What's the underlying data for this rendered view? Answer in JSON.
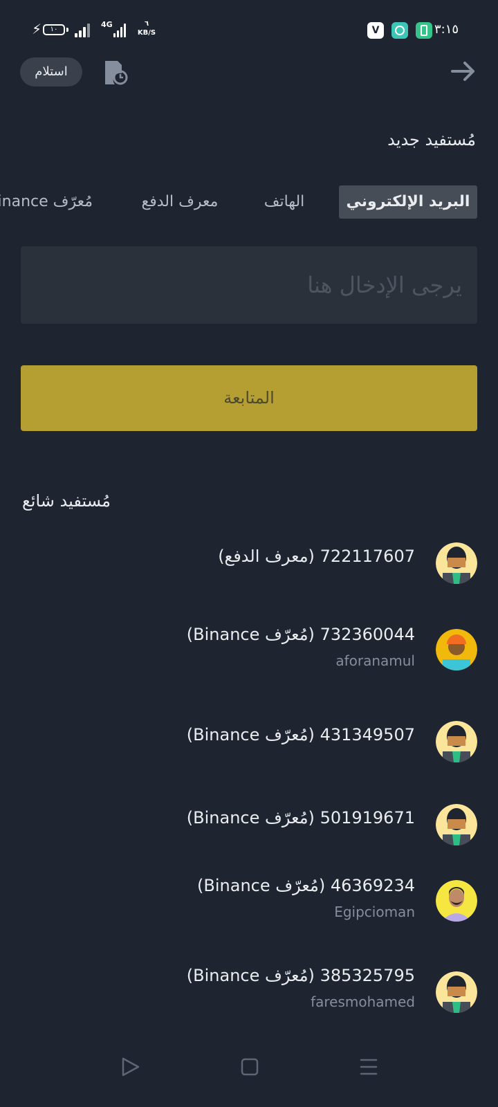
{
  "status_bar": {
    "battery_level": "١٠",
    "network_type": "4G",
    "speed_value": "٦",
    "speed_unit": "KB/S",
    "time": "٣:١٥",
    "app_icons": [
      {
        "name": "v-app-icon",
        "color": "#ffffff",
        "glyph": "V"
      },
      {
        "name": "chat-app-icon",
        "color": "#3cc5b7",
        "glyph": "◉"
      },
      {
        "name": "battery-app-icon",
        "color": "#35c48a",
        "glyph": "▯"
      }
    ]
  },
  "header": {
    "receive_label": "استلام",
    "history_icon": "history-icon",
    "back_icon": "arrow-right-icon"
  },
  "new_recipient": {
    "title": "مُستفيد جديد",
    "tabs": [
      {
        "label": "البريد الإلكتروني",
        "active": true
      },
      {
        "label": "الهاتف",
        "active": false
      },
      {
        "label": "معرف الدفع",
        "active": false
      },
      {
        "label": "مُعرّف Binance",
        "active": false
      }
    ],
    "input_placeholder": "يرجى الإدخال هنا",
    "continue_label": "المتابعة"
  },
  "frequent": {
    "title": "مُستفيد شائع",
    "items": [
      {
        "id": "722117607",
        "type": "(معرف الدفع)",
        "subtitle": "",
        "avatar": "default"
      },
      {
        "id": "732360044",
        "type": "(مُعرّف Binance)",
        "subtitle": "aforanamul",
        "avatar": "orange"
      },
      {
        "id": "431349507",
        "type": "(مُعرّف Binance)",
        "subtitle": "",
        "avatar": "default"
      },
      {
        "id": "501919671",
        "type": "(مُعرّف Binance)",
        "subtitle": "",
        "avatar": "default"
      },
      {
        "id": "46369234",
        "type": "(مُعرّف Binance)",
        "subtitle": "Egipcioman",
        "avatar": "photo"
      },
      {
        "id": "385325795",
        "type": "(مُعرّف Binance)",
        "subtitle": "faresmohamed",
        "avatar": "default"
      }
    ]
  },
  "colors": {
    "background": "#1f2530",
    "accent": "#b59f33",
    "tab_active": "#474d57",
    "input_bg": "#2b313a"
  },
  "nav_bar": {
    "icons": [
      "back-triangle-icon",
      "home-square-icon",
      "menu-lines-icon"
    ]
  }
}
